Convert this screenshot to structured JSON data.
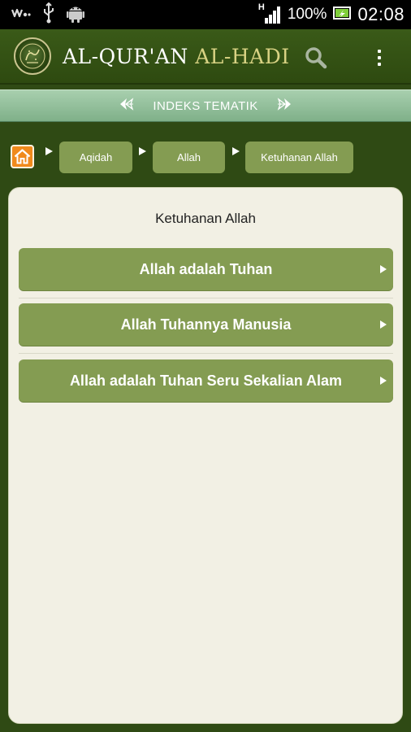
{
  "status_bar": {
    "battery_percent": "100%",
    "time": "02:08",
    "network_label": "H",
    "icons": [
      "walkman-icon",
      "usb-icon",
      "android-icon",
      "signal-icon",
      "battery-icon"
    ]
  },
  "app_bar": {
    "title_part1": "AL-QUR'AN",
    "title_part2": "AL-HADI",
    "icons": [
      "logo-emblem",
      "search-icon",
      "overflow-menu-icon"
    ]
  },
  "section": {
    "title": "INDEKS TEMATIK"
  },
  "breadcrumb": {
    "items": [
      {
        "label": "Aqidah"
      },
      {
        "label": "Allah"
      },
      {
        "label": "Ketuhanan Allah"
      }
    ]
  },
  "content": {
    "title": "Ketuhanan Allah",
    "topics": [
      {
        "label": "Allah adalah Tuhan"
      },
      {
        "label": "Allah Tuhannya Manusia"
      },
      {
        "label": "Allah adalah Tuhan Seru Sekalian Alam"
      }
    ]
  },
  "colors": {
    "app_bar": "#2e4a10",
    "title_accent": "#d8d283",
    "section_header": "#8fbc97",
    "item_green": "#849c52",
    "panel_bg": "#f2f0e4",
    "home_orange": "#f08a1c"
  }
}
